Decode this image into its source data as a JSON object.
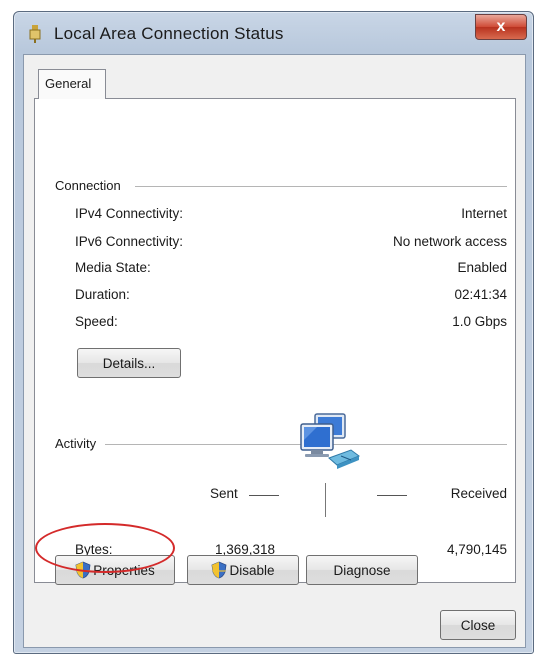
{
  "window": {
    "title": "Local Area Connection Status",
    "close_symbol": "x"
  },
  "tabs": [
    {
      "label": "General",
      "selected": true
    }
  ],
  "connection": {
    "group_label": "Connection",
    "rows": [
      {
        "label": "IPv4 Connectivity:",
        "value": "Internet"
      },
      {
        "label": "IPv6 Connectivity:",
        "value": "No network access"
      },
      {
        "label": "Media State:",
        "value": "Enabled"
      },
      {
        "label": "Duration:",
        "value": "02:41:34"
      },
      {
        "label": "Speed:",
        "value": "1.0 Gbps"
      }
    ],
    "details_label": "Details..."
  },
  "activity": {
    "group_label": "Activity",
    "sent_label": "Sent",
    "received_label": "Received",
    "bytes_label": "Bytes:",
    "bytes_sent": "1,369,318",
    "bytes_received": "4,790,145",
    "icon": "network-computers-icon"
  },
  "buttons": {
    "properties": "Properties",
    "disable": "Disable",
    "diagnose": "Diagnose",
    "close": "Close"
  },
  "colors": {
    "highlight": "#d42a2a",
    "shield_blue": "#3a6fc4",
    "shield_yellow": "#f2c230"
  }
}
